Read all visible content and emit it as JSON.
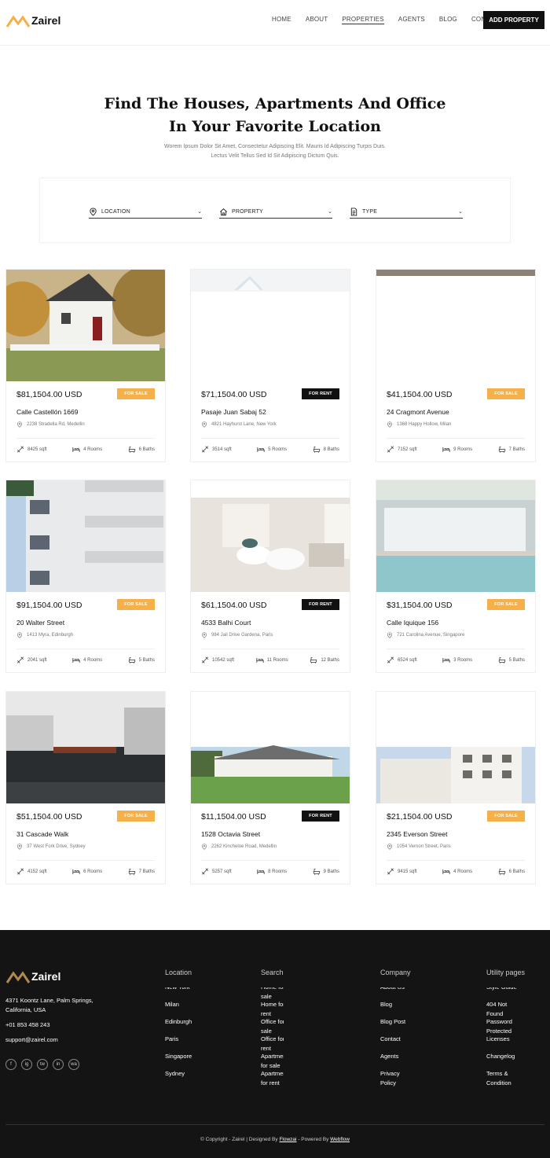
{
  "brand": {
    "name": "Zairel",
    "accent": "#f6b04a"
  },
  "nav": {
    "items": [
      "HOME",
      "ABOUT",
      "PROPERTIES",
      "AGENTS",
      "BLOG",
      "CONTACT"
    ],
    "active": "PROPERTIES",
    "cta": "ADD PROPERTY"
  },
  "hero": {
    "title_line1": "Find The Houses, Apartments And Office",
    "title_line2": "In Your Favorite Location",
    "subtitle": "Worem Ipsum Dolor Sit Amet, Consectetur Adipiscing Elit. Mauris Id Adipiscing Turpis Duis. Lectus Velit Tellus Sed Id Sit Adipiscing Dictum Quis."
  },
  "search": {
    "location": "LOCATION",
    "property": "PROPERTY",
    "type": "TYPE"
  },
  "properties": [
    {
      "price": "$81,1504.00 USD",
      "status": "FOR SALE",
      "name": "Calle Castellón 1669",
      "address": "2238 Stradella Rd, Medellin",
      "sqft": "8425 sqft",
      "rooms": "4 Rooms",
      "baths": "6 Baths"
    },
    {
      "price": "$71,1504.00 USD",
      "status": "FOR RENT",
      "name": "Pasaje Juan Sabaj 52",
      "address": "4821 Hayhurst Lane, New York",
      "sqft": "3514 sqft",
      "rooms": "5 Rooms",
      "baths": "8 Baths"
    },
    {
      "price": "$41,1504.00 USD",
      "status": "FOR SALE",
      "name": "24 Cragmont Avenue",
      "address": "1368 Happy Hollow, Milan",
      "sqft": "7152 sqft",
      "rooms": "9 Rooms",
      "baths": "7 Baths"
    },
    {
      "price": "$91,1504.00 USD",
      "status": "FOR SALE",
      "name": "20 Walter Street",
      "address": "1413 Myra, Edinburgh",
      "sqft": "2041 sqft",
      "rooms": "4 Rooms",
      "baths": "5 Baths"
    },
    {
      "price": "$61,1504.00 USD",
      "status": "FOR RENT",
      "name": "4533 Balhi Court",
      "address": "984 Jail Drive Gardena, Paris",
      "sqft": "10542 sqft",
      "rooms": "11 Rooms",
      "baths": "12 Baths"
    },
    {
      "price": "$31,1504.00 USD",
      "status": "FOR SALE",
      "name": "Calle Iquique 156",
      "address": "721 Carolina Avenue, Singapore",
      "sqft": "6524 sqft",
      "rooms": "3 Rooms",
      "baths": "5 Baths"
    },
    {
      "price": "$51,1504.00 USD",
      "status": "FOR SALE",
      "name": "31 Cascade Walk",
      "address": "37 West Fork Drive, Sydney",
      "sqft": "4152 sqft",
      "rooms": "6 Rooms",
      "baths": "7 Baths"
    },
    {
      "price": "$11,1504.00 USD",
      "status": "FOR RENT",
      "name": "1528 Octavia Street",
      "address": "2262 Kincheloe Road, Medellin",
      "sqft": "5257 sqft",
      "rooms": "8 Rooms",
      "baths": "9 Baths"
    },
    {
      "price": "$21,1504.00 USD",
      "status": "FOR SALE",
      "name": "2345 Everson Street",
      "address": "1054 Vernon Street, Paris",
      "sqft": "9415 sqft",
      "rooms": "4 Rooms",
      "baths": "6 Baths"
    }
  ],
  "footer": {
    "address": "4371 Koontz Lane, Palm Springs, California, USA",
    "phone": "+01 853 458 243",
    "email": "support@zairel.com",
    "socials": [
      "f",
      "ig",
      "tw",
      "in",
      "wa"
    ],
    "columns": [
      {
        "heading": "Location",
        "items": [
          "New York",
          "Milan",
          "Edinburgh",
          "Paris",
          "Singapore",
          "Sydney"
        ]
      },
      {
        "heading": "Search",
        "items": [
          "Home for sale",
          "Home for rent",
          "Office for sale",
          "Office for rent",
          "Apartment for sale",
          "Apartment for rent"
        ]
      },
      {
        "heading": "Company",
        "items": [
          "About Us",
          "Blog",
          "Blog Post",
          "Contact",
          "Agents",
          "Privacy Policy"
        ]
      },
      {
        "heading": "Utility pages",
        "items": [
          "Style Guide",
          "404 Not Found",
          "Password Protected",
          "Licenses",
          "Changelog",
          "Terms & Condition"
        ]
      }
    ],
    "copyright_prefix": "© Copyright - Zairel | Designed By",
    "designer": "Flowzai",
    "powered_prefix": "- Powered By",
    "powered": "Webflow"
  }
}
